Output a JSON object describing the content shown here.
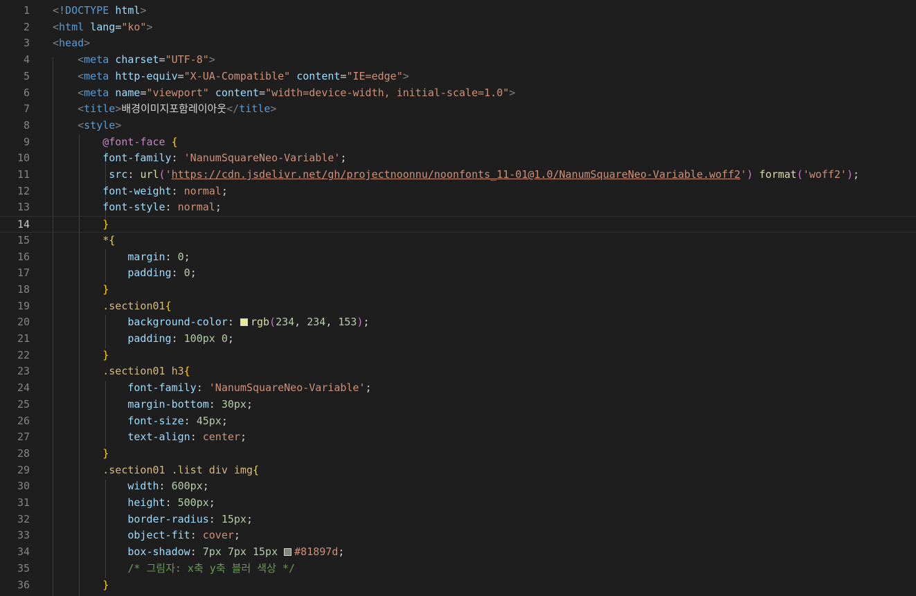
{
  "editor": {
    "current_line": 14,
    "colors": {
      "background": "#1e1e1e",
      "line_number": "#858585",
      "tag": "#569cd6",
      "attribute": "#9cdcfe",
      "string": "#ce9178",
      "number": "#b5cea8",
      "comment": "#6a9955",
      "bracket_yellow": "#ffd700",
      "bracket_pink": "#da70d6",
      "at_rule": "#c586c0",
      "selector": "#d7ba7d"
    },
    "swatches": {
      "line20": "#eaea99",
      "line34": "#81897d"
    },
    "lines": [
      {
        "n": "1",
        "tokens": [
          [
            "tk-punct",
            "<"
          ],
          [
            "tk-tag",
            "!DOCTYPE "
          ],
          [
            "tk-attr",
            "html"
          ],
          [
            "tk-punct",
            ">"
          ]
        ]
      },
      {
        "n": "2",
        "tokens": [
          [
            "tk-punct",
            "<"
          ],
          [
            "tk-tag",
            "html "
          ],
          [
            "tk-attr",
            "lang"
          ],
          [
            "tk-plain",
            "="
          ],
          [
            "tk-str",
            "\"ko\""
          ],
          [
            "tk-punct",
            ">"
          ]
        ]
      },
      {
        "n": "3",
        "tokens": [
          [
            "tk-punct",
            "<"
          ],
          [
            "tk-tag",
            "head"
          ],
          [
            "tk-punct",
            ">"
          ]
        ]
      },
      {
        "n": "4",
        "tokens": [
          [
            "tk-plain",
            "    "
          ],
          [
            "tk-punct",
            "<"
          ],
          [
            "tk-tag",
            "meta "
          ],
          [
            "tk-attr",
            "charset"
          ],
          [
            "tk-plain",
            "="
          ],
          [
            "tk-str",
            "\"UTF-8\""
          ],
          [
            "tk-punct",
            ">"
          ]
        ]
      },
      {
        "n": "5",
        "tokens": [
          [
            "tk-plain",
            "    "
          ],
          [
            "tk-punct",
            "<"
          ],
          [
            "tk-tag",
            "meta "
          ],
          [
            "tk-attr",
            "http-equiv"
          ],
          [
            "tk-plain",
            "="
          ],
          [
            "tk-str",
            "\"X-UA-Compatible\""
          ],
          [
            "tk-plain",
            " "
          ],
          [
            "tk-attr",
            "content"
          ],
          [
            "tk-plain",
            "="
          ],
          [
            "tk-str",
            "\"IE=edge\""
          ],
          [
            "tk-punct",
            ">"
          ]
        ]
      },
      {
        "n": "6",
        "tokens": [
          [
            "tk-plain",
            "    "
          ],
          [
            "tk-punct",
            "<"
          ],
          [
            "tk-tag",
            "meta "
          ],
          [
            "tk-attr",
            "name"
          ],
          [
            "tk-plain",
            "="
          ],
          [
            "tk-str",
            "\"viewport\""
          ],
          [
            "tk-plain",
            " "
          ],
          [
            "tk-attr",
            "content"
          ],
          [
            "tk-plain",
            "="
          ],
          [
            "tk-str",
            "\"width=device-width, initial-scale=1.0\""
          ],
          [
            "tk-punct",
            ">"
          ]
        ]
      },
      {
        "n": "7",
        "tokens": [
          [
            "tk-plain",
            "    "
          ],
          [
            "tk-punct",
            "<"
          ],
          [
            "tk-tag",
            "title"
          ],
          [
            "tk-punct",
            ">"
          ],
          [
            "tk-text",
            "배경이미지포함레이아웃"
          ],
          [
            "tk-punct",
            "</"
          ],
          [
            "tk-tag",
            "title"
          ],
          [
            "tk-punct",
            ">"
          ]
        ]
      },
      {
        "n": "8",
        "tokens": [
          [
            "tk-plain",
            "    "
          ],
          [
            "tk-punct",
            "<"
          ],
          [
            "tk-tag",
            "style"
          ],
          [
            "tk-punct",
            ">"
          ]
        ]
      },
      {
        "n": "9",
        "tokens": [
          [
            "tk-plain",
            "        "
          ],
          [
            "tk-at",
            "@font-face"
          ],
          [
            "tk-plain",
            " "
          ],
          [
            "tk-brace",
            "{"
          ]
        ]
      },
      {
        "n": "10",
        "tokens": [
          [
            "tk-plain",
            "        "
          ],
          [
            "tk-prop",
            "font-family"
          ],
          [
            "tk-plain",
            ": "
          ],
          [
            "tk-val",
            "'NanumSquareNeo-Variable'"
          ],
          [
            "tk-plain",
            ";"
          ]
        ]
      },
      {
        "n": "11",
        "tokens": [
          [
            "tk-plain",
            "         "
          ],
          [
            "tk-prop",
            "src"
          ],
          [
            "tk-plain",
            ": "
          ],
          [
            "tk-fn",
            "url"
          ],
          [
            "tk-paren",
            "("
          ],
          [
            "tk-val",
            "'"
          ],
          [
            "tk-url",
            "https://cdn.jsdelivr.net/gh/projectnoonnu/noonfonts_11-01@1.0/NanumSquareNeo-Variable.woff2"
          ],
          [
            "tk-val",
            "'"
          ],
          [
            "tk-paren",
            ")"
          ],
          [
            "tk-plain",
            " "
          ],
          [
            "tk-fn",
            "format"
          ],
          [
            "tk-paren",
            "("
          ],
          [
            "tk-val",
            "'woff2'"
          ],
          [
            "tk-paren",
            ")"
          ],
          [
            "tk-plain",
            ";"
          ]
        ]
      },
      {
        "n": "12",
        "tokens": [
          [
            "tk-plain",
            "        "
          ],
          [
            "tk-prop",
            "font-weight"
          ],
          [
            "tk-plain",
            ": "
          ],
          [
            "tk-val",
            "normal"
          ],
          [
            "tk-plain",
            ";"
          ]
        ]
      },
      {
        "n": "13",
        "tokens": [
          [
            "tk-plain",
            "        "
          ],
          [
            "tk-prop",
            "font-style"
          ],
          [
            "tk-plain",
            ": "
          ],
          [
            "tk-val",
            "normal"
          ],
          [
            "tk-plain",
            ";"
          ]
        ]
      },
      {
        "n": "14",
        "tokens": [
          [
            "tk-plain",
            "        "
          ],
          [
            "tk-brace",
            "}"
          ]
        ]
      },
      {
        "n": "15",
        "tokens": [
          [
            "tk-plain",
            "        "
          ],
          [
            "tk-sel",
            "*"
          ],
          [
            "tk-brace",
            "{"
          ]
        ]
      },
      {
        "n": "16",
        "tokens": [
          [
            "tk-plain",
            "            "
          ],
          [
            "tk-prop",
            "margin"
          ],
          [
            "tk-plain",
            ": "
          ],
          [
            "tk-num",
            "0"
          ],
          [
            "tk-plain",
            ";"
          ]
        ]
      },
      {
        "n": "17",
        "tokens": [
          [
            "tk-plain",
            "            "
          ],
          [
            "tk-prop",
            "padding"
          ],
          [
            "tk-plain",
            ": "
          ],
          [
            "tk-num",
            "0"
          ],
          [
            "tk-plain",
            ";"
          ]
        ]
      },
      {
        "n": "18",
        "tokens": [
          [
            "tk-plain",
            "        "
          ],
          [
            "tk-brace",
            "}"
          ]
        ]
      },
      {
        "n": "19",
        "tokens": [
          [
            "tk-plain",
            "        "
          ],
          [
            "tk-sel",
            ".section01"
          ],
          [
            "tk-brace",
            "{"
          ]
        ]
      },
      {
        "n": "20",
        "tokens": [
          [
            "tk-plain",
            "            "
          ],
          [
            "tk-prop",
            "background-color"
          ],
          [
            "tk-plain",
            ": "
          ],
          [
            "swatch",
            "line20"
          ],
          [
            "tk-fn",
            "rgb"
          ],
          [
            "tk-paren",
            "("
          ],
          [
            "tk-num",
            "234"
          ],
          [
            "tk-plain",
            ", "
          ],
          [
            "tk-num",
            "234"
          ],
          [
            "tk-plain",
            ", "
          ],
          [
            "tk-num",
            "153"
          ],
          [
            "tk-paren",
            ")"
          ],
          [
            "tk-plain",
            ";"
          ]
        ]
      },
      {
        "n": "21",
        "tokens": [
          [
            "tk-plain",
            "            "
          ],
          [
            "tk-prop",
            "padding"
          ],
          [
            "tk-plain",
            ": "
          ],
          [
            "tk-num",
            "100px"
          ],
          [
            "tk-plain",
            " "
          ],
          [
            "tk-num",
            "0"
          ],
          [
            "tk-plain",
            ";"
          ]
        ]
      },
      {
        "n": "22",
        "tokens": [
          [
            "tk-plain",
            "        "
          ],
          [
            "tk-brace",
            "}"
          ]
        ]
      },
      {
        "n": "23",
        "tokens": [
          [
            "tk-plain",
            "        "
          ],
          [
            "tk-sel",
            ".section01 h3"
          ],
          [
            "tk-brace",
            "{"
          ]
        ]
      },
      {
        "n": "24",
        "tokens": [
          [
            "tk-plain",
            "            "
          ],
          [
            "tk-prop",
            "font-family"
          ],
          [
            "tk-plain",
            ": "
          ],
          [
            "tk-val",
            "'NanumSquareNeo-Variable'"
          ],
          [
            "tk-plain",
            ";"
          ]
        ]
      },
      {
        "n": "25",
        "tokens": [
          [
            "tk-plain",
            "            "
          ],
          [
            "tk-prop",
            "margin-bottom"
          ],
          [
            "tk-plain",
            ": "
          ],
          [
            "tk-num",
            "30px"
          ],
          [
            "tk-plain",
            ";"
          ]
        ]
      },
      {
        "n": "26",
        "tokens": [
          [
            "tk-plain",
            "            "
          ],
          [
            "tk-prop",
            "font-size"
          ],
          [
            "tk-plain",
            ": "
          ],
          [
            "tk-num",
            "45px"
          ],
          [
            "tk-plain",
            ";"
          ]
        ]
      },
      {
        "n": "27",
        "tokens": [
          [
            "tk-plain",
            "            "
          ],
          [
            "tk-prop",
            "text-align"
          ],
          [
            "tk-plain",
            ": "
          ],
          [
            "tk-val",
            "center"
          ],
          [
            "tk-plain",
            ";"
          ]
        ]
      },
      {
        "n": "28",
        "tokens": [
          [
            "tk-plain",
            "        "
          ],
          [
            "tk-brace",
            "}"
          ]
        ]
      },
      {
        "n": "29",
        "tokens": [
          [
            "tk-plain",
            "        "
          ],
          [
            "tk-sel",
            ".section01 .list div img"
          ],
          [
            "tk-brace",
            "{"
          ]
        ]
      },
      {
        "n": "30",
        "tokens": [
          [
            "tk-plain",
            "            "
          ],
          [
            "tk-prop",
            "width"
          ],
          [
            "tk-plain",
            ": "
          ],
          [
            "tk-num",
            "600px"
          ],
          [
            "tk-plain",
            ";"
          ]
        ]
      },
      {
        "n": "31",
        "tokens": [
          [
            "tk-plain",
            "            "
          ],
          [
            "tk-prop",
            "height"
          ],
          [
            "tk-plain",
            ": "
          ],
          [
            "tk-num",
            "500px"
          ],
          [
            "tk-plain",
            ";"
          ]
        ]
      },
      {
        "n": "32",
        "tokens": [
          [
            "tk-plain",
            "            "
          ],
          [
            "tk-prop",
            "border-radius"
          ],
          [
            "tk-plain",
            ": "
          ],
          [
            "tk-num",
            "15px"
          ],
          [
            "tk-plain",
            ";"
          ]
        ]
      },
      {
        "n": "33",
        "tokens": [
          [
            "tk-plain",
            "            "
          ],
          [
            "tk-prop",
            "object-fit"
          ],
          [
            "tk-plain",
            ": "
          ],
          [
            "tk-val",
            "cover"
          ],
          [
            "tk-plain",
            ";"
          ]
        ]
      },
      {
        "n": "34",
        "tokens": [
          [
            "tk-plain",
            "            "
          ],
          [
            "tk-prop",
            "box-shadow"
          ],
          [
            "tk-plain",
            ": "
          ],
          [
            "tk-num",
            "7px"
          ],
          [
            "tk-plain",
            " "
          ],
          [
            "tk-num",
            "7px"
          ],
          [
            "tk-plain",
            " "
          ],
          [
            "tk-num",
            "15px"
          ],
          [
            "tk-plain",
            " "
          ],
          [
            "swatch",
            "line34"
          ],
          [
            "tk-val",
            "#81897d"
          ],
          [
            "tk-plain",
            ";"
          ]
        ]
      },
      {
        "n": "35",
        "tokens": [
          [
            "tk-plain",
            "            "
          ],
          [
            "tk-comment",
            "/* 그림자: x축 y축 블러 색상 */"
          ]
        ]
      },
      {
        "n": "36",
        "tokens": [
          [
            "tk-plain",
            "        "
          ],
          [
            "tk-brace",
            "}"
          ]
        ]
      }
    ]
  }
}
